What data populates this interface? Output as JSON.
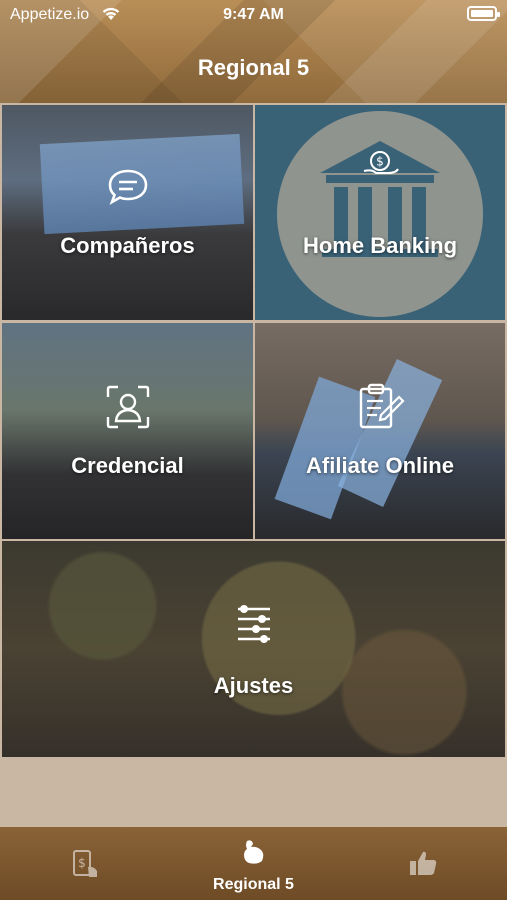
{
  "status": {
    "carrier": "Appetize.io",
    "time": "9:47 AM"
  },
  "header": {
    "title": "Regional 5"
  },
  "tiles": [
    {
      "label": "Compañeros",
      "icon": "chat-icon"
    },
    {
      "label": "Home Banking",
      "icon": "bank-icon"
    },
    {
      "label": "Credencial",
      "icon": "user-id-icon"
    },
    {
      "label": "Afiliate Online",
      "icon": "clipboard-edit-icon"
    },
    {
      "label": "Ajustes",
      "icon": "sliders-icon"
    }
  ],
  "tabbar": {
    "tabs": [
      {
        "label": "",
        "icon": "phone-payment-icon",
        "active": false
      },
      {
        "label": "Regional 5",
        "icon": "flex-arm-icon",
        "active": true
      },
      {
        "label": "",
        "icon": "thumbs-up-icon",
        "active": false
      }
    ]
  },
  "colors": {
    "header_gold": "#8f6a3b",
    "bank_blue": "#3a6277",
    "tabbar_brown": "#6e4b26"
  }
}
